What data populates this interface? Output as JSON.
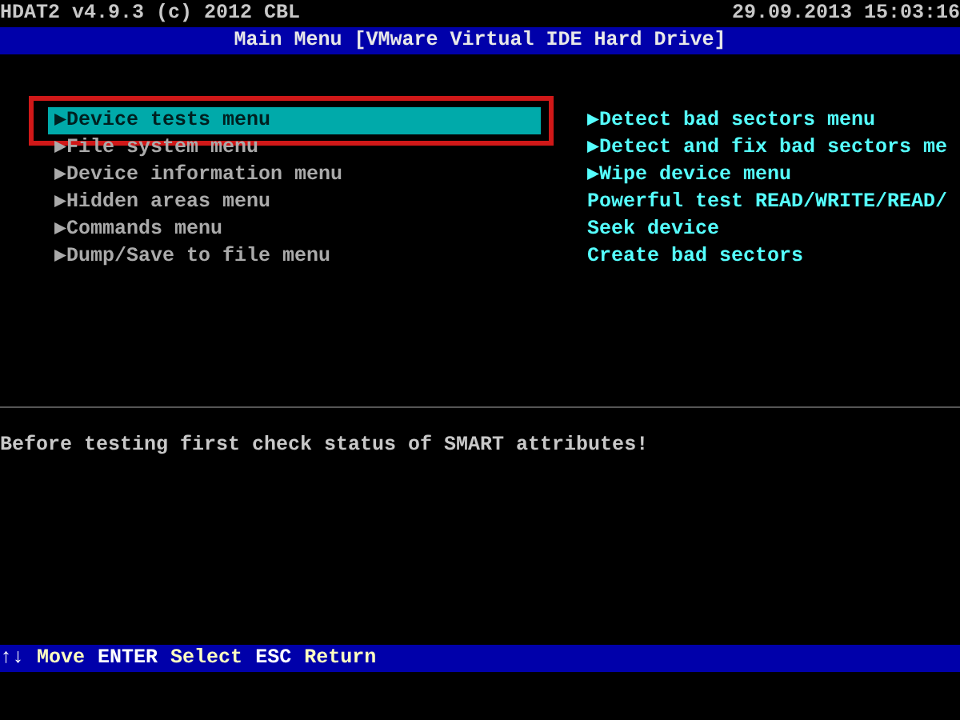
{
  "header": {
    "app": "HDAT2 v4.9.3 (c) 2012 CBL",
    "datetime": "29.09.2013 15:03:16"
  },
  "title_bar": {
    "title": "Main Menu [VMware Virtual IDE Hard Drive]"
  },
  "menu": [
    {
      "label": "▶Device tests menu",
      "selected": true
    },
    {
      "label": "▶File system menu",
      "selected": false
    },
    {
      "label": "▶Device information menu",
      "selected": false
    },
    {
      "label": "▶Hidden areas menu",
      "selected": false
    },
    {
      "label": "▶Commands menu",
      "selected": false
    },
    {
      "label": "▶Dump/Save to file menu",
      "selected": false
    }
  ],
  "submenu": [
    "▶Detect bad sectors menu",
    "▶Detect and fix bad sectors me",
    "▶Wipe device menu",
    "Powerful test READ/WRITE/READ/",
    "Seek device",
    "Create bad sectors"
  ],
  "message": "Before testing first check status of SMART attributes!",
  "status_bar": [
    {
      "key": "↑↓",
      "action": "Move"
    },
    {
      "key": "ENTER",
      "action": "Select"
    },
    {
      "key": "ESC",
      "action": "Return"
    }
  ]
}
